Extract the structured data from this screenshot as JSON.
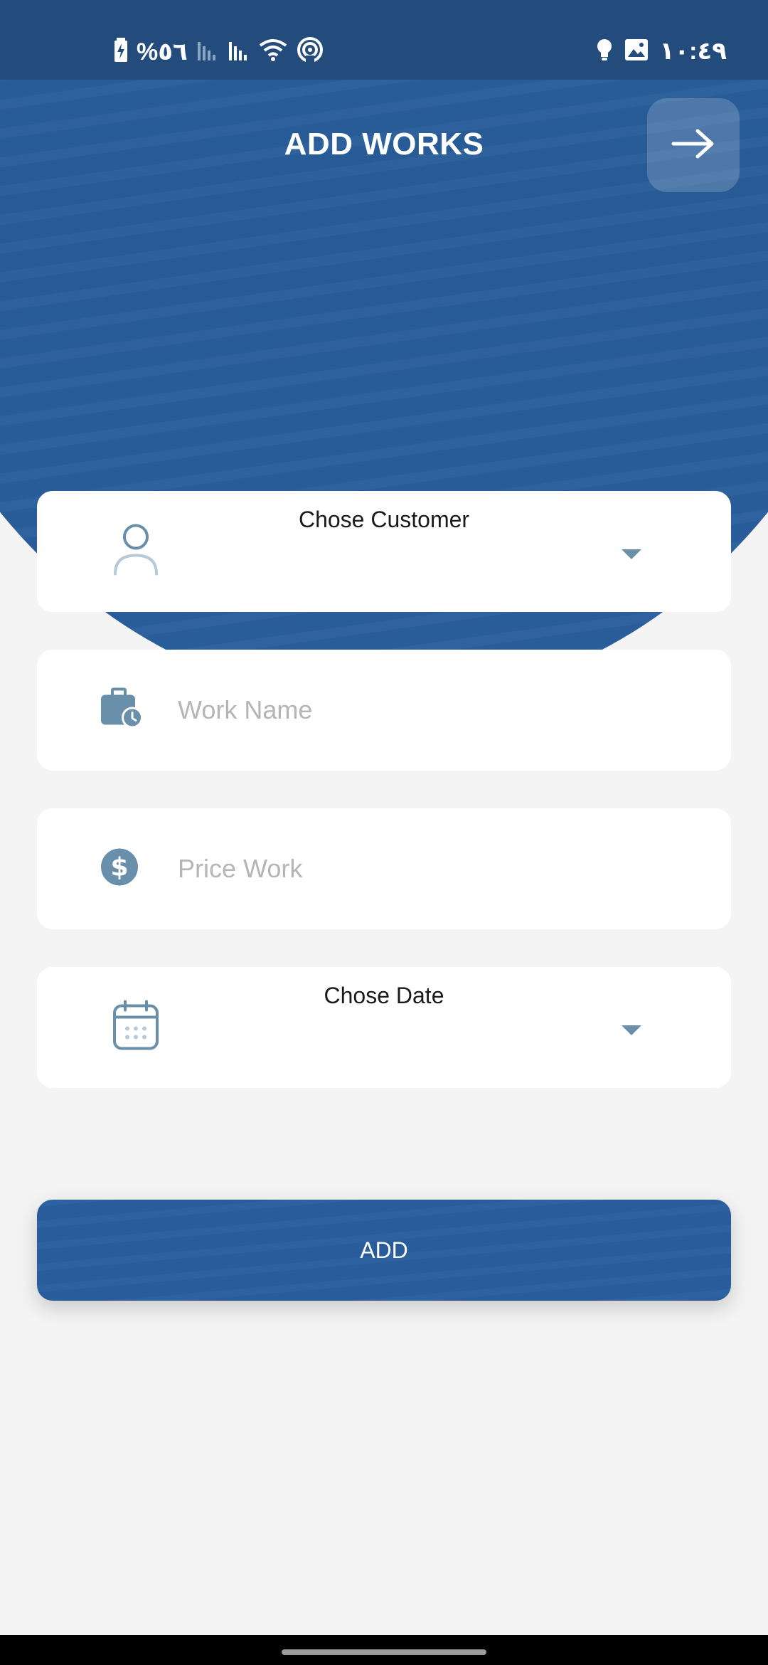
{
  "status_bar": {
    "battery_text": "%٥٦",
    "time": "١٠:٤٩",
    "icons": [
      "battery-charging-icon",
      "signal-icon",
      "signal-icon",
      "wifi-icon",
      "hotspot-icon",
      "bulb-icon",
      "image-icon"
    ]
  },
  "header": {
    "title": "ADD WORKS",
    "back_icon": "arrow-right-icon"
  },
  "form": {
    "customer": {
      "label": "Chose Customer",
      "icon": "person-icon"
    },
    "work_name": {
      "placeholder": "Work Name",
      "value": "",
      "icon": "briefcase-clock-icon"
    },
    "price": {
      "placeholder": "Price Work",
      "value": "",
      "icon": "dollar-icon"
    },
    "date": {
      "label": "Chose Date",
      "icon": "calendar-icon"
    }
  },
  "add_button": {
    "label": "ADD"
  },
  "colors": {
    "primary": "#2a5e9d",
    "status_bar": "#234c7d",
    "icon_tint": "#6a8fab",
    "background": "#f4f4f4"
  }
}
